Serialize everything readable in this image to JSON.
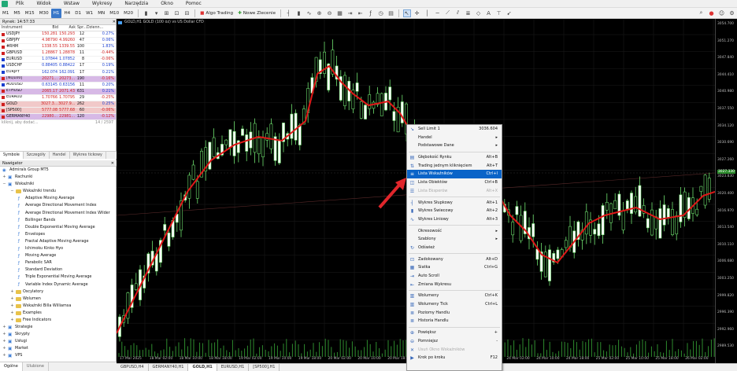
{
  "menu": [
    "Plik",
    "Widok",
    "Wstaw",
    "Wykresy",
    "Narzędzia",
    "Okno",
    "Pomoc"
  ],
  "toolbar": {
    "timeframes": [
      "M1",
      "M5",
      "M15",
      "M30",
      "H1",
      "H4",
      "D1",
      "W1",
      "MN",
      "M10",
      "M20"
    ],
    "algo": "Algo Trading",
    "new_order": "Nowe Zlecenie"
  },
  "market": {
    "title": "Rynek: 14:57:33",
    "headers": [
      "Instrument",
      "Bid",
      "Ask",
      "Spr...",
      "Dzienn..."
    ],
    "rows": [
      {
        "sym": "USDJPY",
        "bid": "150.281",
        "ask": "150.293",
        "spr": "12",
        "chg": "0.27%",
        "dir": "red"
      },
      {
        "sym": "GBPJPY",
        "bid": "4.98790",
        "ask": "4.99260",
        "spr": "47",
        "chg": "0.06%",
        "dir": "red"
      },
      {
        "sym": "#RHM",
        "bid": "1338.55",
        "ask": "1339.55",
        "spr": "100",
        "chg": "1.83%",
        "dir": "red"
      },
      {
        "sym": "GBPUSD",
        "bid": "1.28867",
        "ask": "1.28878",
        "spr": "11",
        "chg": "-0.44%",
        "dir": "red"
      },
      {
        "sym": "EURUSD",
        "bid": "1.07844",
        "ask": "1.07852",
        "spr": "8",
        "chg": "-0.06%",
        "dir": "blue"
      },
      {
        "sym": "USDCHF",
        "bid": "0.88405",
        "ask": "0.88422",
        "spr": "17",
        "chg": "0.19%",
        "dir": "blue"
      },
      {
        "sym": "EURJPY",
        "bid": "162.074",
        "ask": "162.091",
        "spr": "17",
        "chg": "0.21%",
        "dir": "blue"
      },
      {
        "sym": "[NQ100]",
        "bid": "20271...",
        "ask": "20273...",
        "spr": "190",
        "chg": "-0.16%",
        "dir": "red"
      },
      {
        "sym": "AUDUSD",
        "bid": "0.63145",
        "ask": "0.63156",
        "spr": "11",
        "chg": "0.20%",
        "dir": "blue"
      },
      {
        "sym": "ETHUSD",
        "bid": "2065.17",
        "ask": "2071.43",
        "spr": "631",
        "chg": "0.21%",
        "dir": "red"
      },
      {
        "sym": "EURAUD",
        "bid": "1.70766",
        "ask": "1.70795",
        "spr": "29",
        "chg": "-0.25%",
        "dir": "red"
      },
      {
        "sym": "GOLD",
        "bid": "3027.3...",
        "ask": "3027.9...",
        "spr": "262",
        "chg": "0.25%",
        "dir": "red"
      },
      {
        "sym": "[SP500]",
        "bid": "5777.08",
        "ask": "5777.68",
        "spr": "60",
        "chg": "-0.06%",
        "dir": "red"
      },
      {
        "sym": "GERMANY40",
        "bid": "22980...",
        "ask": "22981...",
        "spr": "120",
        "chg": "-0.12%",
        "dir": "red"
      }
    ],
    "add": "kliknij, aby dodać...",
    "count": "14 / 2597"
  },
  "market_tabs": [
    "Symbole",
    "Szczegóły",
    "Handel",
    "Wykres tickowy"
  ],
  "navigator": {
    "title": "Nawigator",
    "items": [
      {
        "t": "Admirals Group MT5",
        "lvl": 0,
        "k": "root"
      },
      {
        "t": "Rachunki",
        "lvl": 0,
        "k": "grp"
      },
      {
        "t": "Wskaźniki",
        "lvl": 0,
        "k": "grp"
      },
      {
        "t": "Wskaźniki trendu",
        "lvl": 1,
        "k": "fold"
      },
      {
        "t": "Adaptive Moving Average",
        "lvl": 2,
        "k": "ind"
      },
      {
        "t": "Average Directional Movement Index",
        "lvl": 2,
        "k": "ind"
      },
      {
        "t": "Average Directional Movement Index Wilder",
        "lvl": 2,
        "k": "ind"
      },
      {
        "t": "Bollinger Bands",
        "lvl": 2,
        "k": "ind"
      },
      {
        "t": "Double Exponential Moving Average",
        "lvl": 2,
        "k": "ind"
      },
      {
        "t": "Envelopes",
        "lvl": 2,
        "k": "ind"
      },
      {
        "t": "Fractal Adaptive Moving Average",
        "lvl": 2,
        "k": "ind"
      },
      {
        "t": "Ichimoku Kinko Hyo",
        "lvl": 2,
        "k": "ind"
      },
      {
        "t": "Moving Average",
        "lvl": 2,
        "k": "ind"
      },
      {
        "t": "Parabolic SAR",
        "lvl": 2,
        "k": "ind"
      },
      {
        "t": "Standard Deviation",
        "lvl": 2,
        "k": "ind"
      },
      {
        "t": "Triple Exponential Moving Average",
        "lvl": 2,
        "k": "ind"
      },
      {
        "t": "Variable Index Dynamic Average",
        "lvl": 2,
        "k": "ind"
      },
      {
        "t": "Oscylatory",
        "lvl": 1,
        "k": "fold"
      },
      {
        "t": "Wolumen",
        "lvl": 1,
        "k": "fold"
      },
      {
        "t": "Wskaźniki Billa Williamsa",
        "lvl": 1,
        "k": "fold"
      },
      {
        "t": "Examples",
        "lvl": 1,
        "k": "fold"
      },
      {
        "t": "Free Indicators",
        "lvl": 1,
        "k": "fold"
      },
      {
        "t": "Strategie",
        "lvl": 0,
        "k": "grp"
      },
      {
        "t": "Skrypty",
        "lvl": 0,
        "k": "grp"
      },
      {
        "t": "Usługi",
        "lvl": 0,
        "k": "grp"
      },
      {
        "t": "Market",
        "lvl": 0,
        "k": "grp"
      },
      {
        "t": "VPS",
        "lvl": 0,
        "k": "grp"
      }
    ]
  },
  "nav_tabs": [
    "Ogólne",
    "Ulubione"
  ],
  "chart": {
    "title": "GOLD,H1 GOLD (100 oz) vs US Dollar CFD",
    "prices": [
      "3054.700",
      "3051.270",
      "3047.840",
      "3044.410",
      "3040.980",
      "3037.550",
      "3034.120",
      "3030.690",
      "3027.260",
      "3023.830",
      "3020.400",
      "3016.970",
      "3013.540",
      "3010.110",
      "3006.680",
      "3003.250",
      "2999.820",
      "2996.390",
      "2992.960",
      "2989.530"
    ],
    "current": "3027.330",
    "times": [
      "17 Mar 2025",
      "18 Mar 02:00",
      "18 Mar 10:00",
      "18 Mar 18:00",
      "19 Mar 02:00",
      "19 Mar 10:00",
      "19 Mar 18:00",
      "20 Mar 02:00",
      "20 Mar 10:00",
      "20 Mar 18:00",
      "21 Mar 02:00",
      "21 Mar 10:00",
      "21 Mar 18:00",
      "24 Mar 02:00",
      "24 Mar 10:00",
      "24 Mar 18:00",
      "25 Mar 02:00",
      "25 Mar 10:00",
      "25 Mar 18:00",
      "26 Mar 02:00"
    ]
  },
  "chart_tabs": [
    "GBPUSD,H4",
    "GERMANY40,H1",
    "GOLD,H1",
    "EURUSD,H1",
    "[SP500],H1"
  ],
  "context_menu": [
    {
      "t": "Sell Limit 1",
      "k": "3036.604",
      "ic": "↘"
    },
    {
      "t": "Handel",
      "k": "▸"
    },
    {
      "t": "Podstawowe Dane",
      "k": "▸"
    },
    {
      "sep": true
    },
    {
      "t": "Głębokość Rynku",
      "k": "Alt+B",
      "ic": "▤"
    },
    {
      "t": "Trading jednym kliknięciem",
      "k": "Alt+T",
      "ic": "⇅"
    },
    {
      "t": "Lista Wskaźników",
      "k": "Ctrl+I",
      "ic": "≡",
      "sel": true
    },
    {
      "t": "Lista Obiektów",
      "k": "Ctrl+B",
      "ic": "◫"
    },
    {
      "t": "Lista Eksperów",
      "k": "Alt+X",
      "dis": true,
      "ic": "☰"
    },
    {
      "sep": true
    },
    {
      "t": "Wykres Słupkowy",
      "k": "Alt+1",
      "ic": "┤"
    },
    {
      "t": "Wykres Świecowy",
      "k": "Alt+2",
      "ic": "▮"
    },
    {
      "t": "Wykres Liniowy",
      "k": "Alt+3",
      "ic": "∿"
    },
    {
      "sep": true
    },
    {
      "t": "Okresowość",
      "k": "▸"
    },
    {
      "t": "Szablony",
      "k": "▸"
    },
    {
      "t": "Odśwież",
      "ic": "↻"
    },
    {
      "sep": true
    },
    {
      "t": "Zadokowany",
      "k": "Alt+D",
      "ic": "⊡"
    },
    {
      "t": "Siatka",
      "k": "Ctrl+G",
      "ic": "▦"
    },
    {
      "t": "Auto Scroll",
      "ic": "⇥"
    },
    {
      "t": "Zmiana Wykresu",
      "ic": "⇤"
    },
    {
      "sep": true
    },
    {
      "t": "Wolumeny",
      "k": "Ctrl+K",
      "ic": "▥"
    },
    {
      "t": "Wolumeny Tick",
      "k": "Ctrl+L",
      "ic": "▥"
    },
    {
      "t": "Poziomy Handlu",
      "ic": "≣"
    },
    {
      "t": "Historia Handlu",
      "ic": "≣"
    },
    {
      "sep": true
    },
    {
      "t": "Powiększ",
      "k": "+",
      "ic": "⊕"
    },
    {
      "t": "Pomniejsz",
      "k": "-",
      "ic": "⊖"
    },
    {
      "t": "Usuń Okno Wskaźników",
      "dis": true,
      "ic": "✕"
    },
    {
      "t": "Krok po kroku",
      "k": "F12",
      "ic": "▶"
    }
  ]
}
